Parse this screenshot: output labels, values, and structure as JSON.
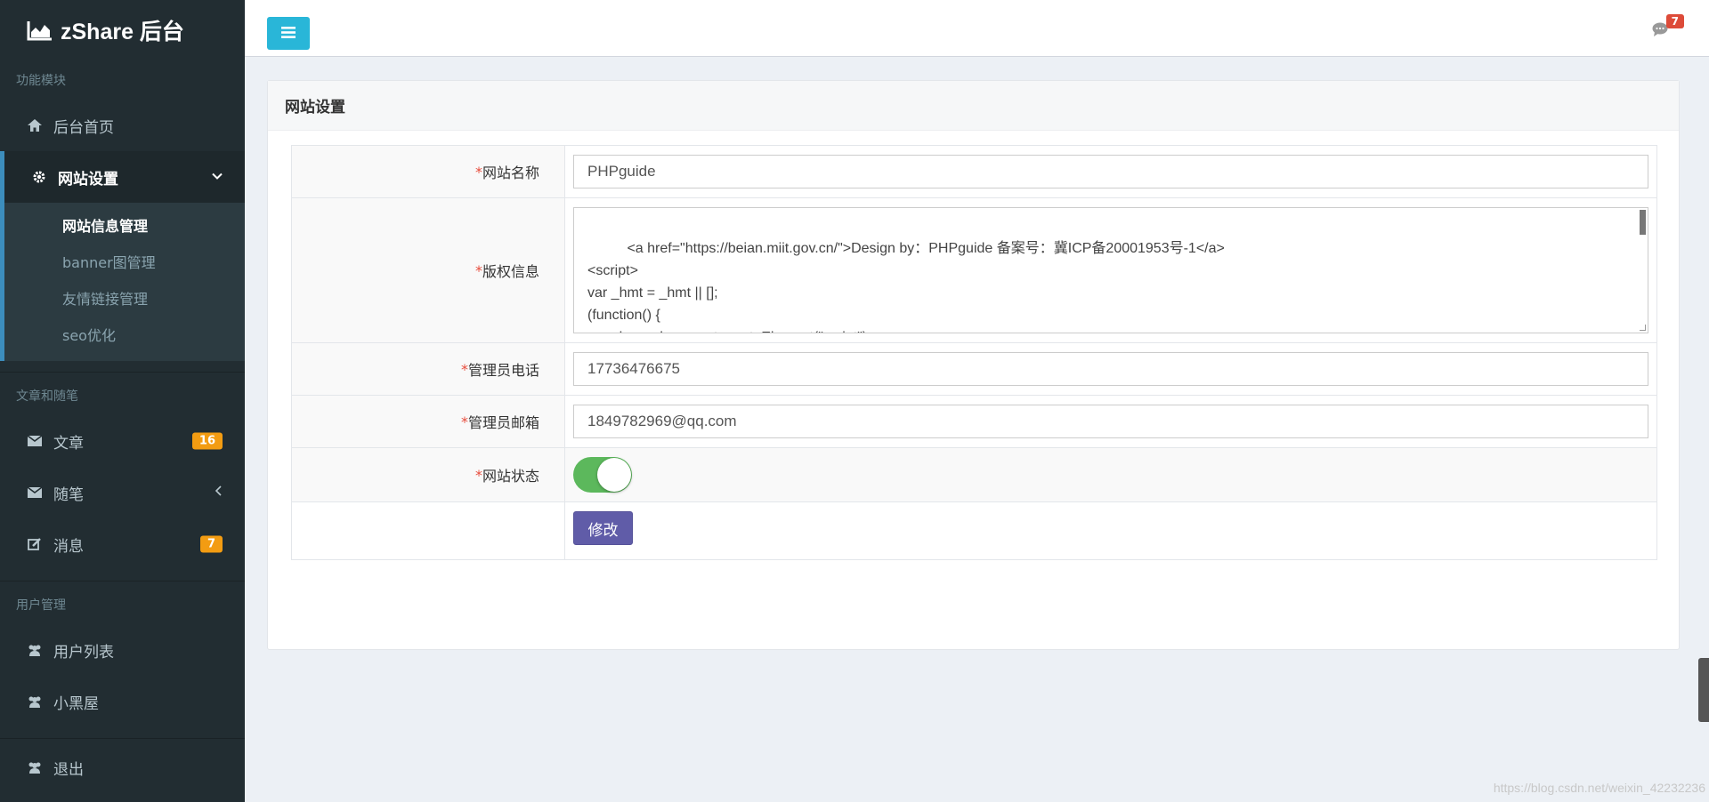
{
  "brand": {
    "title": "zShare 后台"
  },
  "sidebar": {
    "sections": [
      {
        "header": "功能模块"
      },
      {
        "header": "文章和随笔"
      },
      {
        "header": "用户管理"
      }
    ],
    "items": {
      "home": "后台首页",
      "site_settings": "网站设置",
      "sub": [
        "网站信息管理",
        "banner图管理",
        "友情链接管理",
        "seo优化"
      ],
      "articles": "文章",
      "articles_count": "16",
      "essays": "随笔",
      "messages": "消息",
      "messages_count": "7",
      "user_list": "用户列表",
      "blackroom": "小黑屋",
      "logout": "退出"
    }
  },
  "topbar": {
    "notifications_count": "7"
  },
  "panel": {
    "title": "网站设置",
    "required_mark": "*",
    "fields": {
      "site_name_label": "网站名称",
      "site_name_value": "PHPguide",
      "copyright_label": "版权信息",
      "copyright_value": "<a href=\"https://beian.miit.gov.cn/\">Design by：PHPguide 备案号：冀ICP备20001953号-1</a>\n<script>\nvar _hmt = _hmt || [];\n(function() {\n  var hm = document.createElement(\"script\");",
      "phone_label": "管理员电话",
      "phone_value": "17736476675",
      "email_label": "管理员邮箱",
      "email_value": "1849782969@qq.com",
      "status_label": "网站状态",
      "status_on": true
    },
    "submit_label": "修改"
  },
  "watermark": "https://blog.csdn.net/weixin_42232236",
  "colors": {
    "sidebar_bg": "#222d32",
    "accent": "#3c8dbc",
    "menu_btn": "#29b6d8",
    "badge": "#f39c12",
    "toggle_on": "#5cb85c",
    "submit": "#605ca8"
  }
}
